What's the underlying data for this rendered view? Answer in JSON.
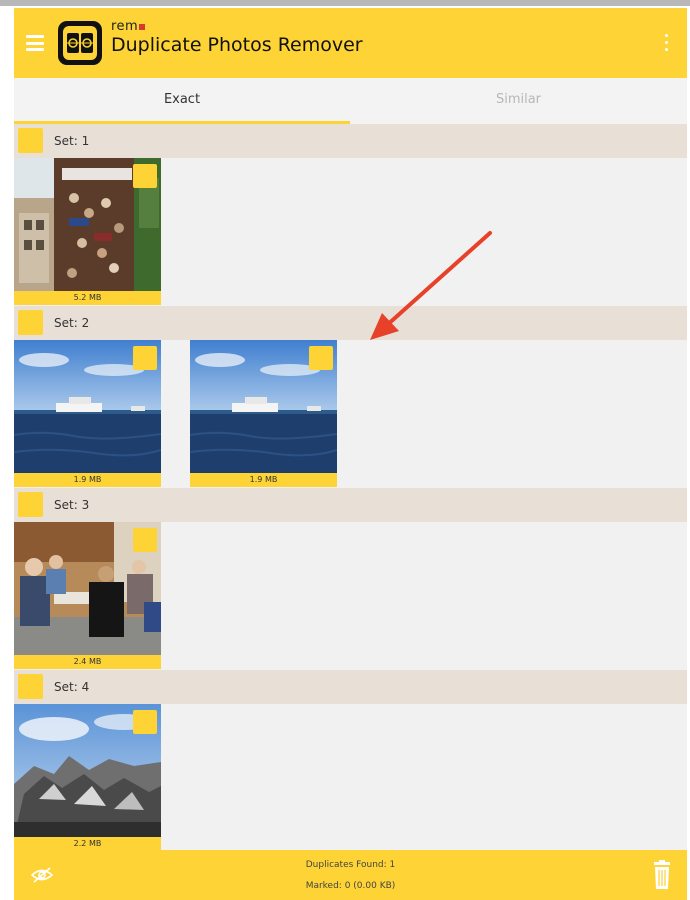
{
  "app": {
    "brand_small": "rem",
    "title": "Duplicate Photos Remover"
  },
  "tabs": [
    {
      "label": "Exact",
      "active": true
    },
    {
      "label": "Similar",
      "active": false
    }
  ],
  "sets": [
    {
      "label": "Set: 1",
      "images": [
        {
          "size": "5.2 MB",
          "subject": "crowd at outdoor event"
        }
      ]
    },
    {
      "label": "Set: 2",
      "images": [
        {
          "size": "1.9 MB",
          "subject": "ship on sea"
        },
        {
          "size": "1.9 MB",
          "subject": "ship on sea"
        }
      ]
    },
    {
      "label": "Set: 3",
      "images": [
        {
          "size": "2.4 MB",
          "subject": "people at table"
        }
      ]
    },
    {
      "label": "Set: 4",
      "images": [
        {
          "size": "2.2 MB",
          "subject": "rocks under sky"
        }
      ]
    }
  ],
  "status": {
    "duplicates_found": "Duplicates Found: 1",
    "marked": "Marked: 0 (0.00 KB)"
  },
  "colors": {
    "accent": "#fdd335",
    "set_header": "#e8e0d6",
    "background": "#f1f1f1",
    "arrow": "#e8412a"
  },
  "icons": [
    "menu-icon",
    "app-logo",
    "more-vert-icon",
    "hide-eye-icon",
    "trash-icon"
  ]
}
